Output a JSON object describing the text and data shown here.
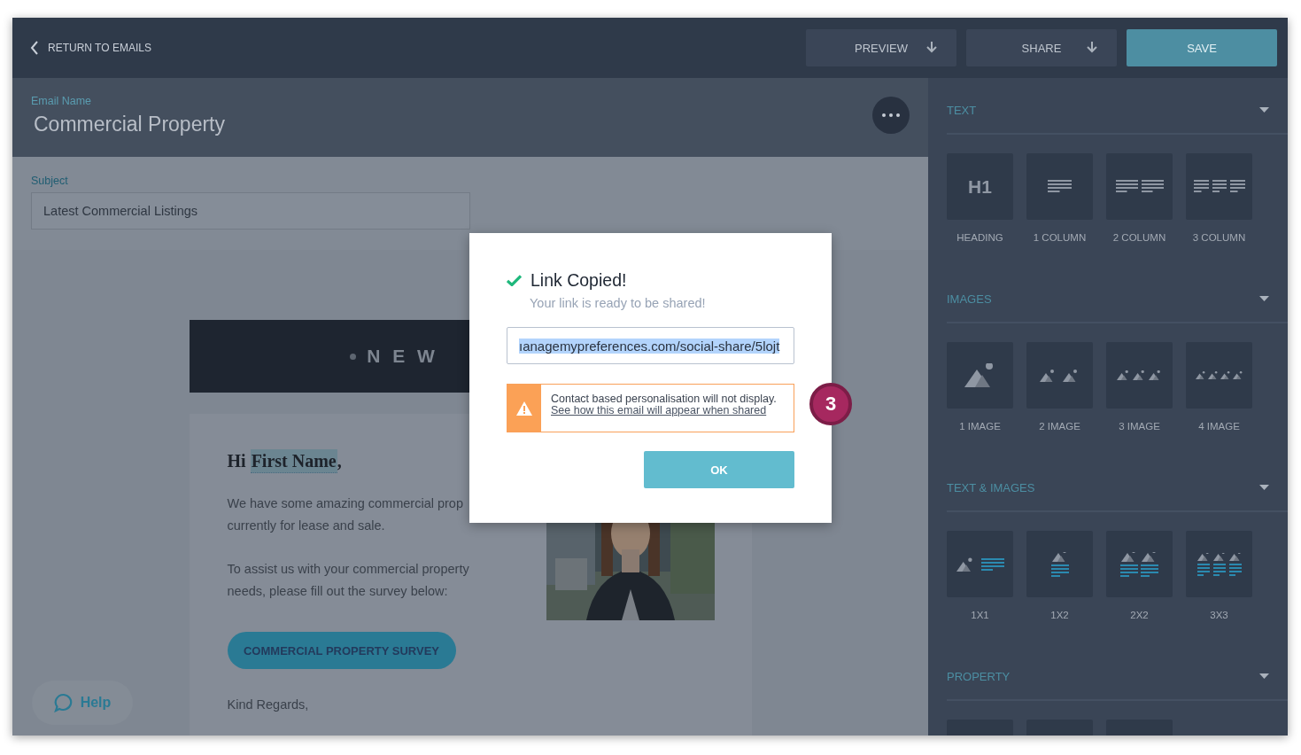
{
  "topbar": {
    "back_label": "RETURN TO EMAILS",
    "buttons": [
      {
        "label": "PREVIEW",
        "kind": "dropdown"
      },
      {
        "label": "SHARE",
        "kind": "dropdown"
      },
      {
        "label": "SAVE",
        "kind": "primary"
      }
    ]
  },
  "email_name": {
    "label": "Email Name",
    "value": "Commercial Property"
  },
  "subject": {
    "label": "Subject",
    "value": "Latest Commercial Listings"
  },
  "email": {
    "banner": "N E W",
    "greeting": {
      "prefix": "Hi ",
      "merge_field": "First Name",
      "suffix": ","
    },
    "paragraphs": [
      {
        "lines": [
          "We have some amazing commercial prop",
          "currently for lease and sale."
        ]
      },
      {
        "lines": [
          "To assist us with your commercial property",
          "needs, please fill out the survey below:"
        ]
      }
    ],
    "cta": "COMMERCIAL PROPERTY SURVEY",
    "closing": "Kind Regards,"
  },
  "help": {
    "label": "Help"
  },
  "sidebar": {
    "sections": [
      {
        "title": "TEXT",
        "items": [
          {
            "kind": "h1",
            "glyph": "H1",
            "label": "HEADING"
          },
          {
            "kind": "col1",
            "label": "1 COLUMN"
          },
          {
            "kind": "col2",
            "label": "2 COLUMN"
          },
          {
            "kind": "col3",
            "label": "3 COLUMN"
          }
        ]
      },
      {
        "title": "IMAGES",
        "items": [
          {
            "kind": "img1",
            "label": "1 IMAGE"
          },
          {
            "kind": "img2",
            "label": "2 IMAGE"
          },
          {
            "kind": "img3",
            "label": "3 IMAGE"
          },
          {
            "kind": "img4",
            "label": "4 IMAGE"
          }
        ]
      },
      {
        "title": "TEXT & IMAGES",
        "items": [
          {
            "kind": "ti1x1",
            "label": "1X1"
          },
          {
            "kind": "ti1x2",
            "label": "1X2"
          },
          {
            "kind": "ti2x2",
            "label": "2X2"
          },
          {
            "kind": "ti3x3",
            "label": "3X3"
          }
        ]
      },
      {
        "title": "PROPERTY",
        "items": [
          {
            "kind": "blank"
          },
          {
            "kind": "blank"
          },
          {
            "kind": "blank"
          }
        ]
      }
    ]
  },
  "modal": {
    "title": "Link Copied!",
    "subtitle": "Your link is ready to be shared!",
    "link_value": "ıanagemypreferences.com/social-share/5lojt",
    "link_selected": true,
    "warning": {
      "text": "Contact based personalisation will not display.",
      "link": "See how this email will appear when shared"
    },
    "ok": "OK"
  },
  "step_badge": "3"
}
